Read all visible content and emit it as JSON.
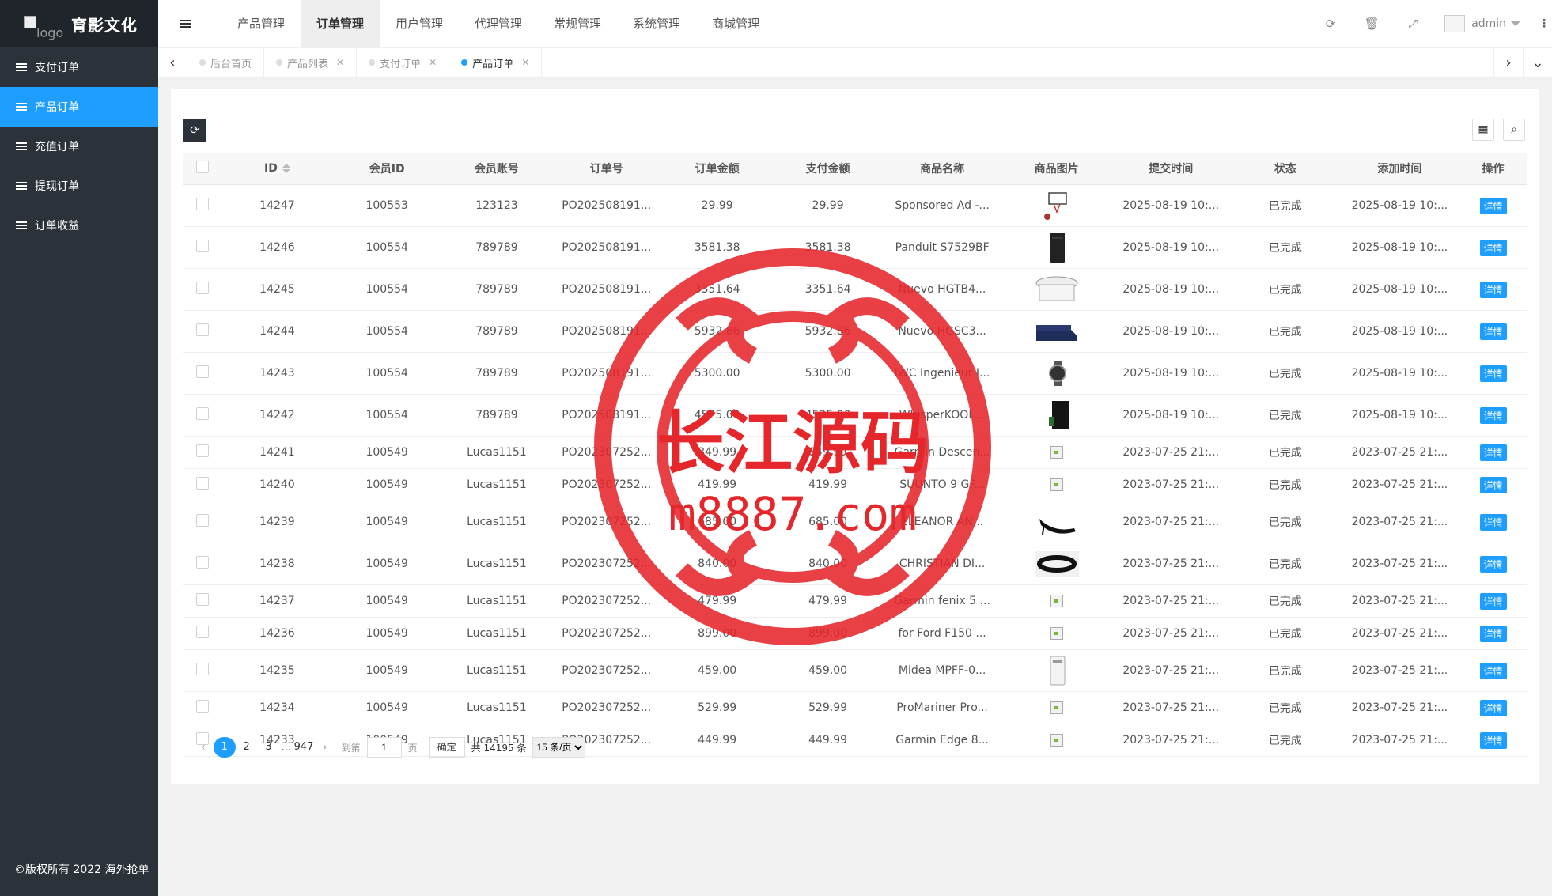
{
  "brand": {
    "title": "育影文化",
    "logo_alt": "logo"
  },
  "sidebar": {
    "items": [
      {
        "label": "支付订单",
        "active": false
      },
      {
        "label": "产品订单",
        "active": true
      },
      {
        "label": "充值订单",
        "active": false
      },
      {
        "label": "提现订单",
        "active": false
      },
      {
        "label": "订单收益",
        "active": false
      }
    ],
    "copyright": "©版权所有 2022 海外抢单"
  },
  "header": {
    "nav": [
      {
        "label": "产品管理",
        "active": false
      },
      {
        "label": "订单管理",
        "active": true
      },
      {
        "label": "用户管理",
        "active": false
      },
      {
        "label": "代理管理",
        "active": false
      },
      {
        "label": "常规管理",
        "active": false
      },
      {
        "label": "系统管理",
        "active": false
      },
      {
        "label": "商城管理",
        "active": false
      }
    ],
    "user": "admin"
  },
  "tabs": [
    {
      "label": "后台首页",
      "active": false,
      "closable": false
    },
    {
      "label": "产品列表",
      "active": false,
      "closable": true
    },
    {
      "label": "支付订单",
      "active": false,
      "closable": true
    },
    {
      "label": "产品订单",
      "active": true,
      "closable": true
    }
  ],
  "table": {
    "columns": [
      "ID",
      "会员ID",
      "会员账号",
      "订单号",
      "订单金额",
      "支付金额",
      "商品名称",
      "商品图片",
      "提交时间",
      "状态",
      "添加时间",
      "操作"
    ],
    "action_label": "详情",
    "rows": [
      {
        "id": "14247",
        "member_id": "100553",
        "account": "123123",
        "order_no": "PO202508191...",
        "order_amount": "29.99",
        "pay_amount": "29.99",
        "product": "Sponsored Ad -...",
        "image": "basketball-hoop",
        "submit_time": "2025-08-19 10:...",
        "status": "已完成",
        "add_time": "2025-08-19 10:..."
      },
      {
        "id": "14246",
        "member_id": "100554",
        "account": "789789",
        "order_no": "PO202508191...",
        "order_amount": "3581.38",
        "pay_amount": "3581.38",
        "product": "Panduit S7529BF",
        "image": "server-rack",
        "submit_time": "2025-08-19 10:...",
        "status": "已完成",
        "add_time": "2025-08-19 10:..."
      },
      {
        "id": "14245",
        "member_id": "100554",
        "account": "789789",
        "order_no": "PO202508191...",
        "order_amount": "3351.64",
        "pay_amount": "3351.64",
        "product": "Nuevo HGTB4...",
        "image": "round-table",
        "submit_time": "2025-08-19 10:...",
        "status": "已完成",
        "add_time": "2025-08-19 10:..."
      },
      {
        "id": "14244",
        "member_id": "100554",
        "account": "789789",
        "order_no": "PO202508191...",
        "order_amount": "5932.86",
        "pay_amount": "5932.86",
        "product": "Nuevo HGSC3...",
        "image": "sofa",
        "submit_time": "2025-08-19 10:...",
        "status": "已完成",
        "add_time": "2025-08-19 10:..."
      },
      {
        "id": "14243",
        "member_id": "100554",
        "account": "789789",
        "order_no": "PO202508191...",
        "order_amount": "5300.00",
        "pay_amount": "5300.00",
        "product": "IWC Ingenieur I...",
        "image": "watch",
        "submit_time": "2025-08-19 10:...",
        "status": "已完成",
        "add_time": "2025-08-19 10:..."
      },
      {
        "id": "14242",
        "member_id": "100554",
        "account": "789789",
        "order_no": "PO202508191...",
        "order_amount": "4525.00",
        "pay_amount": "4525.00",
        "product": "WhisperKOOL...",
        "image": "cooling-unit",
        "submit_time": "2025-08-19 10:...",
        "status": "已完成",
        "add_time": "2025-08-19 10:..."
      },
      {
        "id": "14241",
        "member_id": "100549",
        "account": "Lucas1151",
        "order_no": "PO202307252...",
        "order_amount": "849.99",
        "pay_amount": "849.99",
        "product": "Garmin Descen...",
        "image": "broken",
        "submit_time": "2023-07-25 21:...",
        "status": "已完成",
        "add_time": "2023-07-25 21:..."
      },
      {
        "id": "14240",
        "member_id": "100549",
        "account": "Lucas1151",
        "order_no": "PO202307252...",
        "order_amount": "419.99",
        "pay_amount": "419.99",
        "product": "SUUNTO 9 GP...",
        "image": "broken",
        "submit_time": "2023-07-25 21:...",
        "status": "已完成",
        "add_time": "2023-07-25 21:..."
      },
      {
        "id": "14239",
        "member_id": "100549",
        "account": "Lucas1151",
        "order_no": "PO202307252...",
        "order_amount": "685.00",
        "pay_amount": "685.00",
        "product": "ELEANOR AN...",
        "image": "heels",
        "submit_time": "2023-07-25 21:...",
        "status": "已完成",
        "add_time": "2023-07-25 21:..."
      },
      {
        "id": "14238",
        "member_id": "100549",
        "account": "Lucas1151",
        "order_no": "PO202307252...",
        "order_amount": "840.00",
        "pay_amount": "840.00",
        "product": "CHRISTIAN DI...",
        "image": "belt",
        "submit_time": "2023-07-25 21:...",
        "status": "已完成",
        "add_time": "2023-07-25 21:..."
      },
      {
        "id": "14237",
        "member_id": "100549",
        "account": "Lucas1151",
        "order_no": "PO202307252...",
        "order_amount": "479.99",
        "pay_amount": "479.99",
        "product": "Garmin fenix 5 ...",
        "image": "broken",
        "submit_time": "2023-07-25 21:...",
        "status": "已完成",
        "add_time": "2023-07-25 21:..."
      },
      {
        "id": "14236",
        "member_id": "100549",
        "account": "Lucas1151",
        "order_no": "PO202307252...",
        "order_amount": "899.00",
        "pay_amount": "899.00",
        "product": "for Ford F150 ...",
        "image": "broken",
        "submit_time": "2023-07-25 21:...",
        "status": "已完成",
        "add_time": "2023-07-25 21:..."
      },
      {
        "id": "14235",
        "member_id": "100549",
        "account": "Lucas1151",
        "order_no": "PO202307252...",
        "order_amount": "459.00",
        "pay_amount": "459.00",
        "product": "Midea MPFF-0...",
        "image": "air-conditioner",
        "submit_time": "2023-07-25 21:...",
        "status": "已完成",
        "add_time": "2023-07-25 21:..."
      },
      {
        "id": "14234",
        "member_id": "100549",
        "account": "Lucas1151",
        "order_no": "PO202307252...",
        "order_amount": "529.99",
        "pay_amount": "529.99",
        "product": "ProMariner Pro...",
        "image": "broken",
        "submit_time": "2023-07-25 21:...",
        "status": "已完成",
        "add_time": "2023-07-25 21:..."
      },
      {
        "id": "14233",
        "member_id": "100549",
        "account": "Lucas1151",
        "order_no": "PO202307252...",
        "order_amount": "449.99",
        "pay_amount": "449.99",
        "product": "Garmin Edge 8...",
        "image": "broken",
        "submit_time": "2023-07-25 21:...",
        "status": "已完成",
        "add_time": "2023-07-25 21:..."
      }
    ]
  },
  "pager": {
    "pages": [
      "1",
      "2",
      "3"
    ],
    "ellipsis": "...",
    "last_page": "947",
    "goto_label": "到第",
    "goto_value": "1",
    "page_unit": "页",
    "ok_label": "确定",
    "total_text": "共 14195 条",
    "page_size_option": "15 条/页"
  },
  "watermark": {
    "line1": "长江源码",
    "line2": "m8887.com",
    "color": "#e5262b"
  }
}
